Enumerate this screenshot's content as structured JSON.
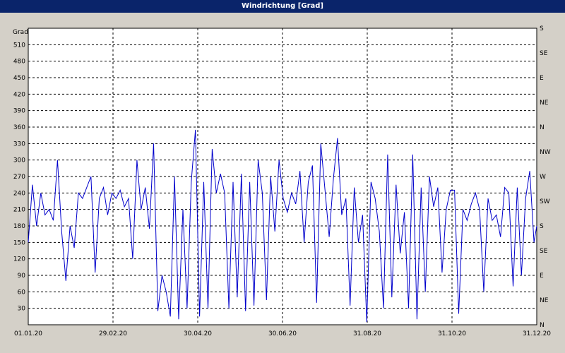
{
  "window": {
    "title": "Windrichtung [Grad]"
  },
  "chart_data": {
    "type": "line",
    "title": "Windrichtung [Grad]",
    "ylabel": "Grad",
    "ylim": [
      0,
      540
    ],
    "xlim": [
      "2020-01-01",
      "2020-12-31"
    ],
    "grid": true,
    "y_ticks": [
      30,
      60,
      90,
      120,
      150,
      180,
      210,
      240,
      270,
      300,
      330,
      360,
      390,
      420,
      450,
      480,
      510
    ],
    "x_ticks": [
      "01.01.20",
      "29.02.20",
      "30.04.20",
      "30.06.20",
      "31.08.20",
      "31.10.20",
      "31.12.20"
    ],
    "right_axis_labels": [
      "S",
      "SE",
      "E",
      "NE",
      "N",
      "NW",
      "W",
      "SW",
      "S",
      "SE",
      "E",
      "NE",
      "N"
    ],
    "series": [
      {
        "color": "#0000cc",
        "x": [
          "2020-01-01",
          "2020-01-04",
          "2020-01-07",
          "2020-01-10",
          "2020-01-13",
          "2020-01-16",
          "2020-01-19",
          "2020-01-22",
          "2020-01-25",
          "2020-01-28",
          "2020-01-31",
          "2020-02-03",
          "2020-02-06",
          "2020-02-09",
          "2020-02-12",
          "2020-02-15",
          "2020-02-18",
          "2020-02-21",
          "2020-02-24",
          "2020-02-27",
          "2020-03-01",
          "2020-03-04",
          "2020-03-07",
          "2020-03-10",
          "2020-03-13",
          "2020-03-16",
          "2020-03-19",
          "2020-03-22",
          "2020-03-25",
          "2020-03-28",
          "2020-03-31",
          "2020-04-03",
          "2020-04-06",
          "2020-04-09",
          "2020-04-12",
          "2020-04-15",
          "2020-04-18",
          "2020-04-21",
          "2020-04-24",
          "2020-04-27",
          "2020-04-30",
          "2020-05-03",
          "2020-05-06",
          "2020-05-09",
          "2020-05-12",
          "2020-05-15",
          "2020-05-18",
          "2020-05-21",
          "2020-05-24",
          "2020-05-27",
          "2020-05-30",
          "2020-06-02",
          "2020-06-05",
          "2020-06-08",
          "2020-06-11",
          "2020-06-14",
          "2020-06-17",
          "2020-06-20",
          "2020-06-23",
          "2020-06-26",
          "2020-06-29",
          "2020-07-02",
          "2020-07-05",
          "2020-07-08",
          "2020-07-11",
          "2020-07-14",
          "2020-07-17",
          "2020-07-20",
          "2020-07-23",
          "2020-07-26",
          "2020-07-29",
          "2020-08-01",
          "2020-08-04",
          "2020-08-07",
          "2020-08-10",
          "2020-08-13",
          "2020-08-16",
          "2020-08-19",
          "2020-08-22",
          "2020-08-25",
          "2020-08-28",
          "2020-08-31",
          "2020-09-03",
          "2020-09-06",
          "2020-09-09",
          "2020-09-12",
          "2020-09-15",
          "2020-09-18",
          "2020-09-21",
          "2020-09-24",
          "2020-09-27",
          "2020-09-30",
          "2020-10-03",
          "2020-10-06",
          "2020-10-09",
          "2020-10-12",
          "2020-10-15",
          "2020-10-18",
          "2020-10-21",
          "2020-10-24",
          "2020-10-27",
          "2020-10-30",
          "2020-11-02",
          "2020-11-05",
          "2020-11-08",
          "2020-11-11",
          "2020-11-14",
          "2020-11-17",
          "2020-11-20",
          "2020-11-23",
          "2020-11-26",
          "2020-11-29",
          "2020-12-02",
          "2020-12-05",
          "2020-12-08",
          "2020-12-11",
          "2020-12-14",
          "2020-12-17",
          "2020-12-20",
          "2020-12-23",
          "2020-12-26",
          "2020-12-29",
          "2020-12-31"
        ],
        "values": [
          150,
          255,
          180,
          240,
          200,
          210,
          190,
          300,
          170,
          80,
          180,
          140,
          240,
          230,
          250,
          270,
          95,
          230,
          250,
          200,
          240,
          230,
          245,
          215,
          230,
          120,
          300,
          210,
          250,
          175,
          330,
          25,
          90,
          60,
          15,
          270,
          10,
          210,
          30,
          260,
          355,
          15,
          260,
          30,
          320,
          240,
          275,
          240,
          30,
          260,
          50,
          275,
          25,
          260,
          35,
          300,
          240,
          45,
          270,
          170,
          300,
          230,
          205,
          240,
          220,
          280,
          150,
          260,
          290,
          40,
          330,
          245,
          160,
          265,
          340,
          200,
          230,
          35,
          250,
          150,
          200,
          5,
          260,
          230,
          170,
          30,
          310,
          50,
          255,
          130,
          205,
          30,
          310,
          10,
          250,
          60,
          270,
          215,
          250,
          95,
          210,
          245,
          245,
          20,
          210,
          190,
          220,
          240,
          210,
          60,
          230,
          190,
          200,
          160,
          250,
          240,
          70,
          250,
          90,
          230,
          280,
          150,
          180
        ]
      }
    ]
  }
}
